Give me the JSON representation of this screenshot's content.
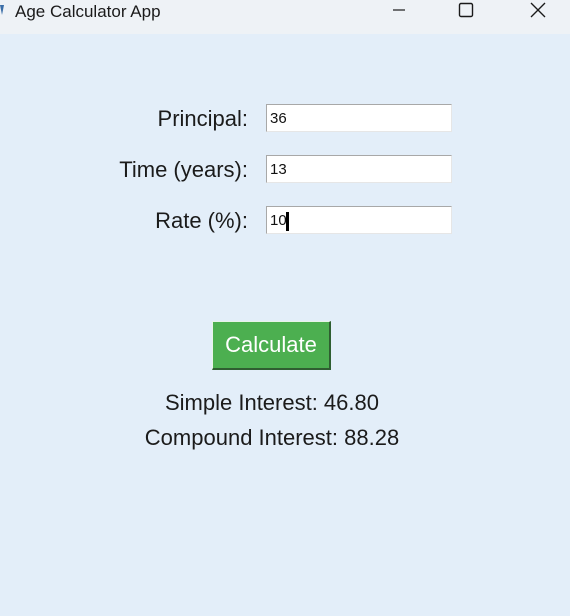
{
  "window": {
    "title": "Age Calculator App",
    "controls": [
      "minimize",
      "maximize",
      "close"
    ]
  },
  "form": {
    "principal": {
      "label": "Principal:",
      "value": "36"
    },
    "time": {
      "label": "Time (years):",
      "value": "13"
    },
    "rate": {
      "label": "Rate (%):",
      "value": "10"
    }
  },
  "actions": {
    "calculate_label": "Calculate"
  },
  "results": {
    "simple_interest": "Simple Interest: 46.80",
    "compound_interest": "Compound Interest: 88.28"
  },
  "colors": {
    "background": "#e3eef9",
    "button": "#4caf50",
    "button_text": "#ffffff"
  }
}
